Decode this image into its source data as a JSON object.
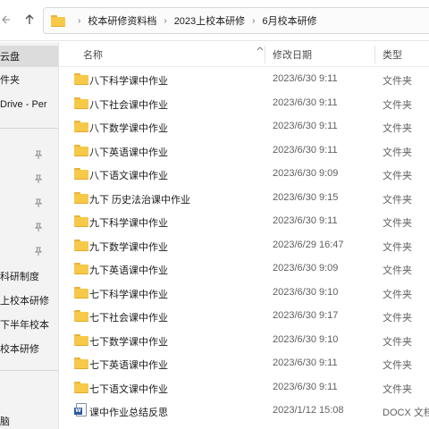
{
  "nav": {
    "back_icon": "arrow-left-icon",
    "up_icon": "arrow-up-icon"
  },
  "address": {
    "folder_icon": "folder-icon",
    "breadcrumbs": [
      "校本研修资料档",
      "2023上校本研修",
      "6月校本研修"
    ]
  },
  "sidebar": {
    "items": [
      {
        "label": "云盘",
        "selected": true
      },
      {
        "label": "件夹",
        "selected": false
      },
      {
        "label": "Drive - Per",
        "selected": false
      },
      {
        "label": "",
        "pinned": true
      },
      {
        "label": "",
        "pinned": true
      },
      {
        "label": "",
        "pinned": true
      },
      {
        "label": "",
        "pinned": true
      },
      {
        "label": "",
        "pinned": true
      },
      {
        "label": "科研制度",
        "selected": false
      },
      {
        "label": "上校本研修",
        "selected": false
      },
      {
        "label": "下半年校本",
        "selected": false
      },
      {
        "label": "校本研修",
        "selected": false
      },
      {
        "label": "脑",
        "selected": false
      }
    ]
  },
  "columns": {
    "name": "名称",
    "modified": "修改日期",
    "type": "类型"
  },
  "files": [
    {
      "name": "八下科学课中作业",
      "modified": "2023/6/30 9:11",
      "type": "文件夹",
      "kind": "folder"
    },
    {
      "name": "八下社会课中作业",
      "modified": "2023/6/30 9:11",
      "type": "文件夹",
      "kind": "folder"
    },
    {
      "name": "八下数学课中作业",
      "modified": "2023/6/30 9:11",
      "type": "文件夹",
      "kind": "folder"
    },
    {
      "name": "八下英语课中作业",
      "modified": "2023/6/30 9:11",
      "type": "文件夹",
      "kind": "folder"
    },
    {
      "name": "八下语文课中作业",
      "modified": "2023/6/30 9:09",
      "type": "文件夹",
      "kind": "folder"
    },
    {
      "name": "九下 历史法治课中作业",
      "modified": "2023/6/30 9:15",
      "type": "文件夹",
      "kind": "folder"
    },
    {
      "name": "九下科学课中作业",
      "modified": "2023/6/30 9:11",
      "type": "文件夹",
      "kind": "folder"
    },
    {
      "name": "九下数学课中作业",
      "modified": "2023/6/29 16:47",
      "type": "文件夹",
      "kind": "folder"
    },
    {
      "name": "九下英语课中作业",
      "modified": "2023/6/30 9:09",
      "type": "文件夹",
      "kind": "folder"
    },
    {
      "name": "七下科学课中作业",
      "modified": "2023/6/30 9:10",
      "type": "文件夹",
      "kind": "folder"
    },
    {
      "name": "七下社会课中作业",
      "modified": "2023/6/30 9:17",
      "type": "文件夹",
      "kind": "folder"
    },
    {
      "name": "七下数学课中作业",
      "modified": "2023/6/30 9:10",
      "type": "文件夹",
      "kind": "folder"
    },
    {
      "name": "七下英语课中作业",
      "modified": "2023/6/30 9:11",
      "type": "文件夹",
      "kind": "folder"
    },
    {
      "name": "七下语文课中作业",
      "modified": "2023/6/30 9:11",
      "type": "文件夹",
      "kind": "folder"
    },
    {
      "name": "课中作业总结反思",
      "modified": "2023/1/12 15:08",
      "type": "DOCX 文档",
      "kind": "docx"
    }
  ]
}
